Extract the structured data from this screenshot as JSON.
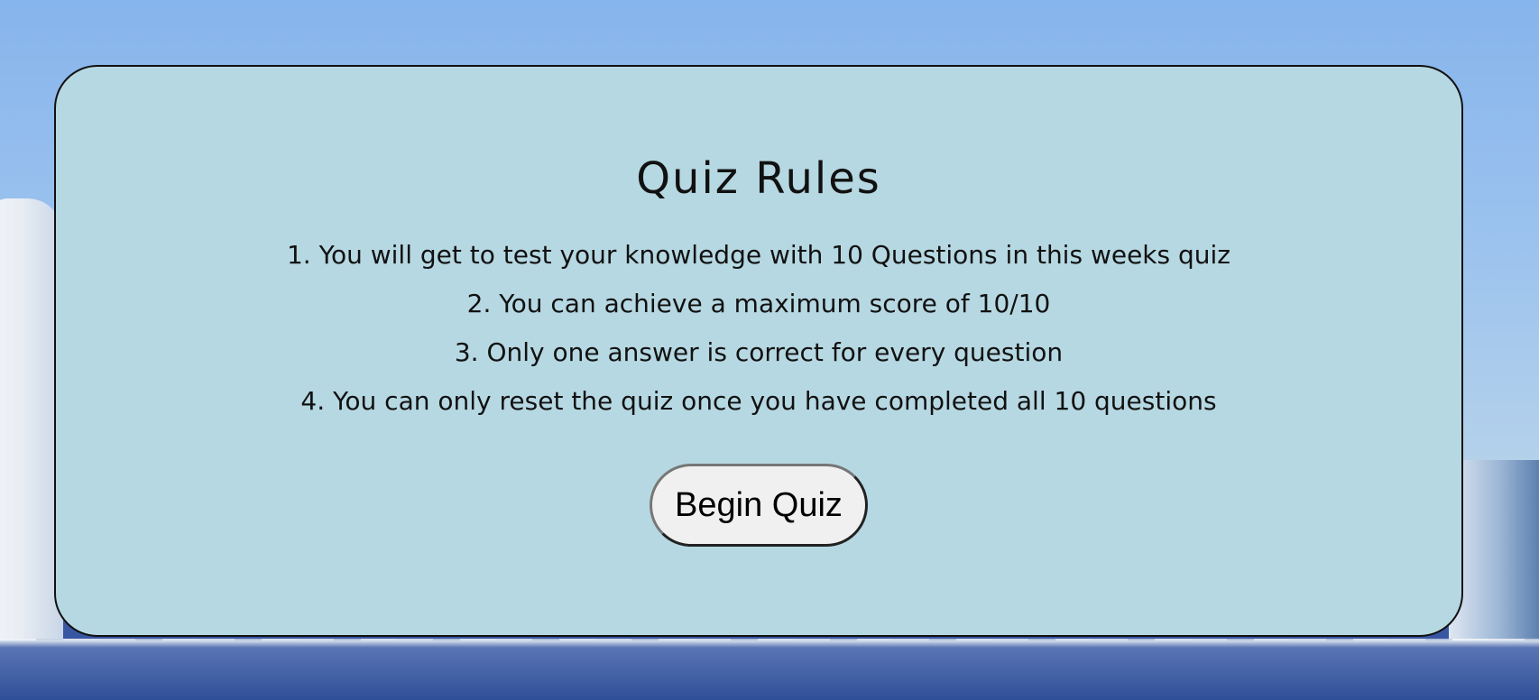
{
  "rules": {
    "title": "Quiz Rules",
    "items": [
      "1. You will get to test your knowledge with 10 Questions in this weeks quiz",
      "2. You can achieve a maximum score of 10/10",
      "3. Only one answer is correct for every question",
      "4. You can only reset the quiz once you have completed all 10 questions"
    ],
    "begin_button_label": "Begin Quiz"
  },
  "colors": {
    "card_background": "#b6d8e2",
    "card_border": "#111111",
    "button_background": "#f0f0f0"
  }
}
